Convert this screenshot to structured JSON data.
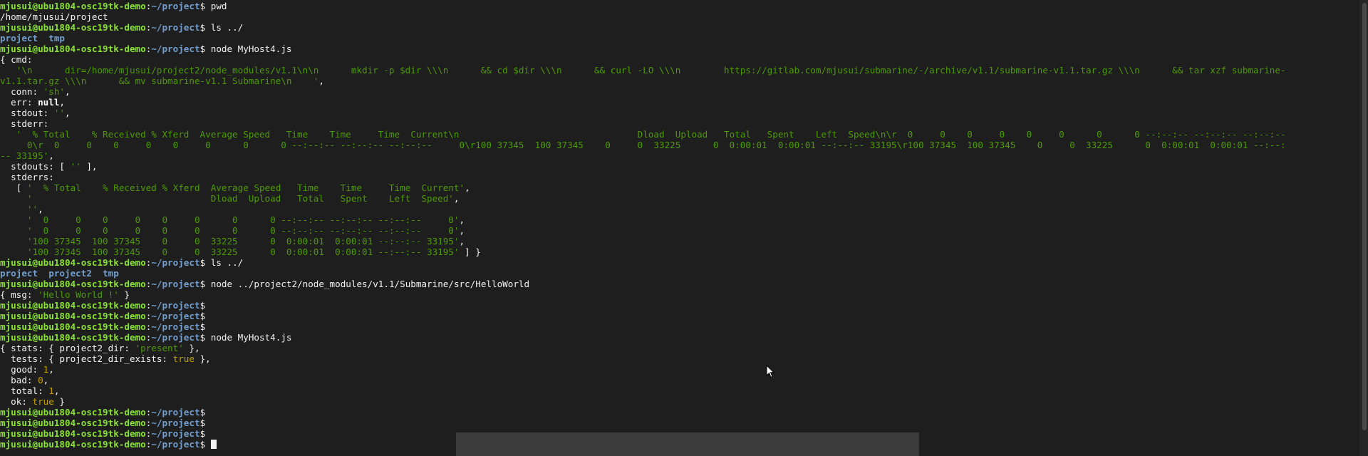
{
  "prompt": {
    "user": "mjusui@ubu1804-osc19tk-demo",
    "path": "~/project",
    "symbol": "$"
  },
  "lines": [
    {
      "t": "prompt",
      "cmd": "pwd"
    },
    {
      "t": "text",
      "segs": [
        {
          "c": "w",
          "s": "/home/mjusui/project"
        }
      ]
    },
    {
      "t": "prompt",
      "cmd": "ls ../"
    },
    {
      "t": "text",
      "segs": [
        {
          "c": "dir",
          "s": "project"
        },
        {
          "c": "w",
          "s": "  "
        },
        {
          "c": "dir",
          "s": "tmp"
        }
      ]
    },
    {
      "t": "prompt",
      "cmd": "node MyHost4.js"
    },
    {
      "t": "text",
      "segs": [
        {
          "c": "w",
          "s": "{ cmd:"
        }
      ]
    },
    {
      "t": "text",
      "segs": [
        {
          "c": "str",
          "s": "   '\\n      dir=/home/mjusui/project2/node_modules/v1.1\\n\\n      mkdir -p $dir \\\\\\n      && cd $dir \\\\\\n      && curl -LO \\\\\\n        https://gitlab.com/mjusui/submarine/-/archive/v1.1/submarine-v1.1.tar.gz \\\\\\n      && tar xzf submarine-"
        }
      ]
    },
    {
      "t": "text",
      "segs": [
        {
          "c": "str",
          "s": "v1.1.tar.gz \\\\\\n      && mv submarine-v1.1 Submarine\\n    '"
        },
        {
          "c": "w",
          "s": ","
        }
      ]
    },
    {
      "t": "text",
      "segs": [
        {
          "c": "w",
          "s": "  conn: "
        },
        {
          "c": "str",
          "s": "'sh'"
        },
        {
          "c": "w",
          "s": ","
        }
      ]
    },
    {
      "t": "text",
      "segs": [
        {
          "c": "w",
          "s": "  err: "
        },
        {
          "c": "b",
          "s": "null"
        },
        {
          "c": "w",
          "s": ","
        }
      ]
    },
    {
      "t": "text",
      "segs": [
        {
          "c": "w",
          "s": "  stdout: "
        },
        {
          "c": "str",
          "s": "''"
        },
        {
          "c": "w",
          "s": ","
        }
      ]
    },
    {
      "t": "text",
      "segs": [
        {
          "c": "w",
          "s": "  stderr:"
        }
      ]
    },
    {
      "t": "text",
      "segs": [
        {
          "c": "str",
          "s": "   '  % Total    % Received % Xferd  Average Speed   Time    Time     Time  Current\\n                                 Dload  Upload   Total   Spent    Left  Speed\\n\\r  0     0    0     0    0     0      0      0 --:--:-- --:--:-- --:--:--"
        }
      ]
    },
    {
      "t": "text",
      "segs": [
        {
          "c": "str",
          "s": "     0\\r  0     0    0     0    0     0      0      0 --:--:-- --:--:-- --:--:--     0\\r100 37345  100 37345    0     0  33225      0  0:00:01  0:00:01 --:--:-- 33195\\r100 37345  100 37345    0     0  33225      0  0:00:01  0:00:01 --:--:"
        }
      ]
    },
    {
      "t": "text",
      "segs": [
        {
          "c": "str",
          "s": "-- 33195'"
        },
        {
          "c": "w",
          "s": ","
        }
      ]
    },
    {
      "t": "text",
      "segs": [
        {
          "c": "w",
          "s": "  stdouts: [ "
        },
        {
          "c": "str",
          "s": "''"
        },
        {
          "c": "w",
          "s": " ],"
        }
      ]
    },
    {
      "t": "text",
      "segs": [
        {
          "c": "w",
          "s": "  stderrs:"
        }
      ]
    },
    {
      "t": "text",
      "segs": [
        {
          "c": "w",
          "s": "   [ "
        },
        {
          "c": "str",
          "s": "'  % Total    % Received % Xferd  Average Speed   Time    Time     Time  Current'"
        },
        {
          "c": "w",
          "s": ","
        }
      ]
    },
    {
      "t": "text",
      "segs": [
        {
          "c": "str",
          "s": "     '                                 Dload  Upload   Total   Spent    Left  Speed'"
        },
        {
          "c": "w",
          "s": ","
        }
      ]
    },
    {
      "t": "text",
      "segs": [
        {
          "c": "str",
          "s": "     ''"
        },
        {
          "c": "w",
          "s": ","
        }
      ]
    },
    {
      "t": "text",
      "segs": [
        {
          "c": "str",
          "s": "     '  0     0    0     0    0     0      0      0 --:--:-- --:--:-- --:--:--     0'"
        },
        {
          "c": "w",
          "s": ","
        }
      ]
    },
    {
      "t": "text",
      "segs": [
        {
          "c": "str",
          "s": "     '  0     0    0     0    0     0      0      0 --:--:-- --:--:-- --:--:--     0'"
        },
        {
          "c": "w",
          "s": ","
        }
      ]
    },
    {
      "t": "text",
      "segs": [
        {
          "c": "str",
          "s": "     '100 37345  100 37345    0     0  33225      0  0:00:01  0:00:01 --:--:-- 33195'"
        },
        {
          "c": "w",
          "s": ","
        }
      ]
    },
    {
      "t": "text",
      "segs": [
        {
          "c": "str",
          "s": "     '100 37345  100 37345    0     0  33225      0  0:00:01  0:00:01 --:--:-- 33195'"
        },
        {
          "c": "w",
          "s": " ] }"
        }
      ]
    },
    {
      "t": "prompt",
      "cmd": "ls ../"
    },
    {
      "t": "text",
      "segs": [
        {
          "c": "dir",
          "s": "project"
        },
        {
          "c": "w",
          "s": "  "
        },
        {
          "c": "dir",
          "s": "project2"
        },
        {
          "c": "w",
          "s": "  "
        },
        {
          "c": "dir",
          "s": "tmp"
        }
      ]
    },
    {
      "t": "prompt",
      "cmd": "node ../project2/node_modules/v1.1/Submarine/src/HelloWorld"
    },
    {
      "t": "text",
      "segs": [
        {
          "c": "w",
          "s": "{ msg: "
        },
        {
          "c": "str",
          "s": "'Hello World !'"
        },
        {
          "c": "w",
          "s": " }"
        }
      ]
    },
    {
      "t": "prompt",
      "cmd": ""
    },
    {
      "t": "prompt",
      "cmd": ""
    },
    {
      "t": "prompt",
      "cmd": ""
    },
    {
      "t": "prompt",
      "cmd": "node MyHost4.js"
    },
    {
      "t": "text",
      "segs": [
        {
          "c": "w",
          "s": "{ stats: { project2_dir: "
        },
        {
          "c": "str",
          "s": "'present'"
        },
        {
          "c": "w",
          "s": " },"
        }
      ]
    },
    {
      "t": "text",
      "segs": [
        {
          "c": "w",
          "s": "  tests: { project2_dir_exists: "
        },
        {
          "c": "num",
          "s": "true"
        },
        {
          "c": "w",
          "s": " },"
        }
      ]
    },
    {
      "t": "text",
      "segs": [
        {
          "c": "w",
          "s": "  good: "
        },
        {
          "c": "num",
          "s": "1"
        },
        {
          "c": "w",
          "s": ","
        }
      ]
    },
    {
      "t": "text",
      "segs": [
        {
          "c": "w",
          "s": "  bad: "
        },
        {
          "c": "num",
          "s": "0"
        },
        {
          "c": "w",
          "s": ","
        }
      ]
    },
    {
      "t": "text",
      "segs": [
        {
          "c": "w",
          "s": "  total: "
        },
        {
          "c": "num",
          "s": "1"
        },
        {
          "c": "w",
          "s": ","
        }
      ]
    },
    {
      "t": "text",
      "segs": [
        {
          "c": "w",
          "s": "  ok: "
        },
        {
          "c": "num",
          "s": "true"
        },
        {
          "c": "w",
          "s": " }"
        }
      ]
    },
    {
      "t": "prompt",
      "cmd": ""
    },
    {
      "t": "prompt",
      "cmd": ""
    },
    {
      "t": "prompt",
      "cmd": ""
    },
    {
      "t": "prompt",
      "cmd": "",
      "cursor": true
    }
  ],
  "colors": {
    "user_host": "#8ae234",
    "path": "#729fcf",
    "string": "#4e9a06",
    "number": "#c4a000",
    "foreground": "#f2f2f2",
    "background": "#1c1c1c"
  },
  "icons": {
    "pointer": "mouse-pointer-icon"
  }
}
